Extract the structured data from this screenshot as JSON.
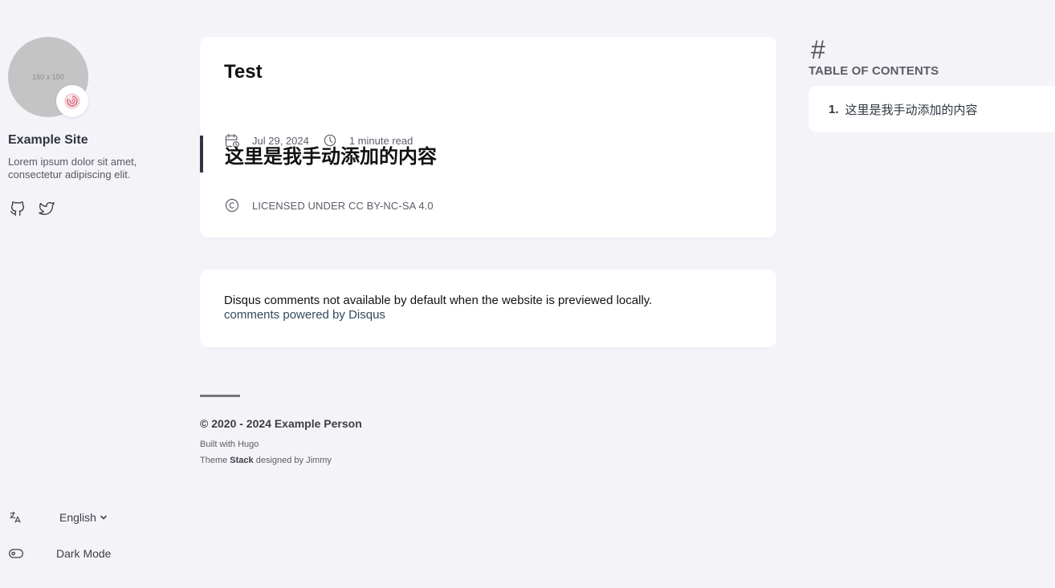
{
  "sidebar": {
    "avatar_placeholder": "150 x 150",
    "avatar_emoji": "🍥",
    "site_name": "Example Site",
    "site_description": "Lorem ipsum dolor sit amet, consectetur adipiscing elit.",
    "social": [
      {
        "icon": "github-icon"
      },
      {
        "icon": "twitter-icon"
      }
    ],
    "language": {
      "icon": "language-icon",
      "selected": "English"
    },
    "dark_mode": {
      "icon": "toggle-icon",
      "label": "Dark Mode"
    }
  },
  "article": {
    "title": "Test",
    "date": "Jul 29, 2024",
    "reading_time": "1 minute read",
    "heading": "这里是我手动添加的内容",
    "license": "LICENSED UNDER CC BY-NC-SA 4.0"
  },
  "comments": {
    "notice": "Disqus comments not available by default when the website is previewed locally.",
    "link": "comments powered by Disqus"
  },
  "footer": {
    "copyright": "© 2020 - 2024 Example Person",
    "built_with": "Built with Hugo",
    "theme_prefix": "Theme ",
    "theme_name": "Stack",
    "theme_suffix": " designed by Jimmy"
  },
  "toc": {
    "hash_symbol": "#",
    "title": "TABLE OF CONTENTS",
    "items": [
      {
        "number": "1.",
        "label": "这里是我手动添加的内容"
      }
    ]
  },
  "colors": {
    "background": "#f4f3f8",
    "card": "#ffffff",
    "accent_bar": "#2f3640",
    "link": "#34495e"
  }
}
